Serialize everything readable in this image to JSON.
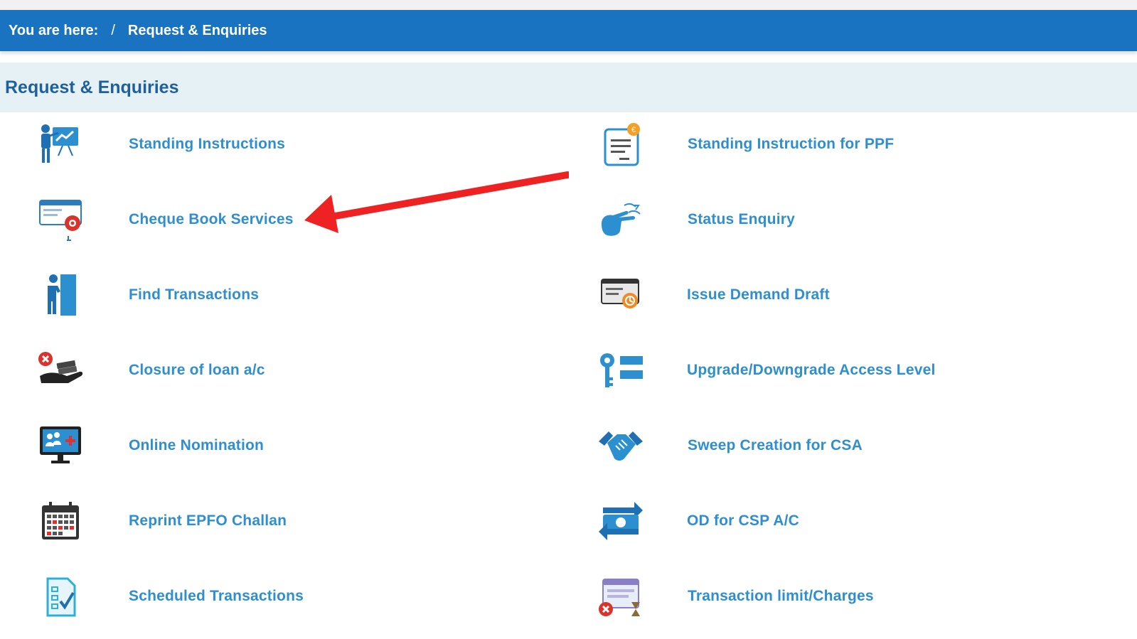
{
  "breadcrumb": {
    "prefix": "You are here:",
    "separator": "/",
    "current": "Request & Enquiries"
  },
  "section": {
    "title": "Request & Enquiries"
  },
  "left_items": [
    {
      "label": "Standing Instructions",
      "icon": "presentation-board-icon"
    },
    {
      "label": "Cheque Book Services",
      "icon": "cheque-settings-icon"
    },
    {
      "label": "Find Transactions",
      "icon": "person-door-icon"
    },
    {
      "label": "Closure of loan a/c",
      "icon": "hand-money-close-icon"
    },
    {
      "label": "Online Nomination",
      "icon": "monitor-users-icon"
    },
    {
      "label": "Reprint EPFO Challan",
      "icon": "calendar-icon"
    },
    {
      "label": "Scheduled Transactions",
      "icon": "checklist-document-icon"
    }
  ],
  "right_items": [
    {
      "label": "Standing Instruction for PPF",
      "icon": "document-coin-icon"
    },
    {
      "label": "Status Enquiry",
      "icon": "pointing-hand-icon"
    },
    {
      "label": "Issue Demand Draft",
      "icon": "draft-card-icon"
    },
    {
      "label": "Upgrade/Downgrade Access Level",
      "icon": "key-access-icon"
    },
    {
      "label": "Sweep Creation for CSA",
      "icon": "handshake-icon"
    },
    {
      "label": "OD for CSP A/C",
      "icon": "cash-exchange-icon"
    },
    {
      "label": "Transaction limit/Charges",
      "icon": "limit-hourglass-icon"
    }
  ],
  "colors": {
    "header_blue": "#1a73c1",
    "section_bg": "#e5f1f5",
    "link_blue": "#2f8fce",
    "annotation_arrow": "#ee2222"
  }
}
